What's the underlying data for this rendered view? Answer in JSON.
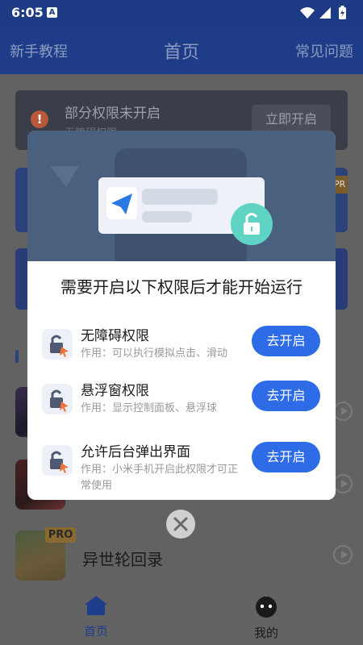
{
  "status_bar": {
    "time": "6:05",
    "notification_letter": "A"
  },
  "header": {
    "left": "新手教程",
    "title": "首页",
    "right": "常见问题"
  },
  "background": {
    "permission_banner": {
      "text": "部分权限未开启",
      "sub": "无障碍权限",
      "button": "立即开启"
    },
    "card_a_tag": "PRO",
    "last_game": {
      "badge": "PRO",
      "name": "异世轮回录"
    }
  },
  "bottom_nav": {
    "home": "首页",
    "mine": "我的"
  },
  "modal": {
    "title": "需要开启以下权限后才能开始运行",
    "items": [
      {
        "title": "无障碍权限",
        "desc": "作用：可以执行模拟点击、滑动",
        "button": "去开启"
      },
      {
        "title": "悬浮窗权限",
        "desc": "作用：显示控制面板、悬浮球",
        "button": "去开启"
      },
      {
        "title": "允许后台弹出界面",
        "desc": "作用：小米手机开启此权限才可正常使用",
        "button": "去开启"
      }
    ]
  },
  "colors": {
    "accent": "#2e6be6",
    "header_bg": "#1e3c87",
    "modal_illustration_bg": "#4a607f",
    "unlock_green": "#5fd3c4"
  }
}
